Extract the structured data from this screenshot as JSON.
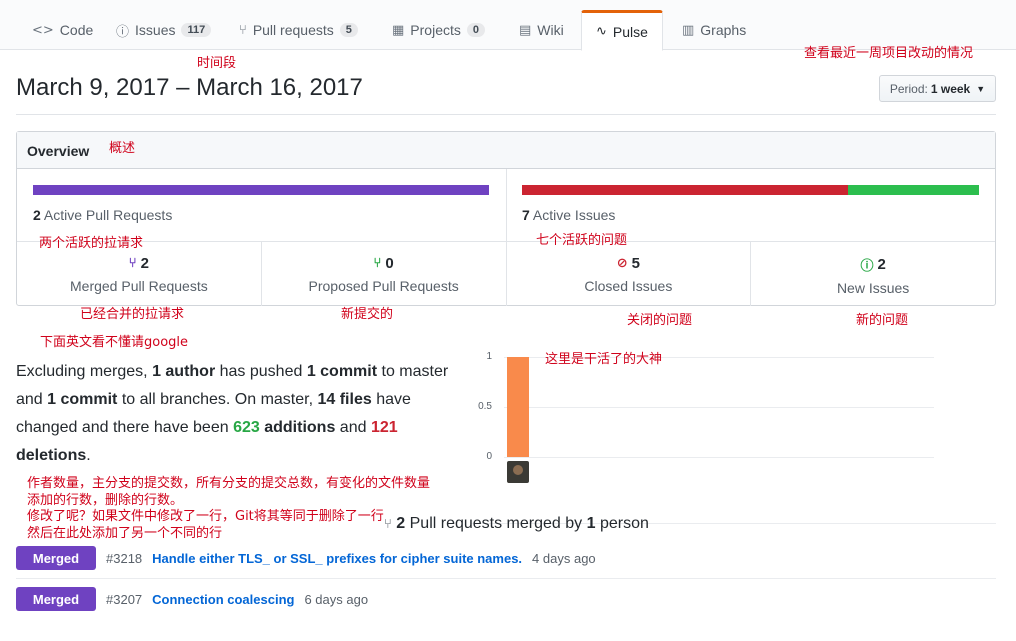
{
  "tabs": [
    {
      "icon": "code-icon",
      "glyph": "<>",
      "label": "Code",
      "count": ""
    },
    {
      "icon": "issue-icon",
      "glyph": "ⓘ",
      "label": "Issues",
      "count": "117"
    },
    {
      "icon": "pull-request-icon",
      "glyph": "⑂",
      "label": "Pull requests",
      "count": "5"
    },
    {
      "icon": "project-icon",
      "glyph": "▦",
      "label": "Projects",
      "count": "0"
    },
    {
      "icon": "wiki-icon",
      "glyph": "▤",
      "label": "Wiki",
      "count": ""
    },
    {
      "icon": "pulse-icon",
      "glyph": "∿",
      "label": "Pulse",
      "count": ""
    },
    {
      "icon": "graph-icon",
      "glyph": "▥",
      "label": "Graphs",
      "count": ""
    }
  ],
  "header": {
    "date_range": "March 9, 2017 – March 16, 2017",
    "period_label": "Period:",
    "period_value": "1 week"
  },
  "overview": {
    "title": "Overview",
    "active_prs_count": "2",
    "active_prs_label": "Active Pull Requests",
    "active_issues_count": "7",
    "active_issues_label": "Active Issues",
    "merged_prs_count": "2",
    "merged_prs_label": "Merged Pull Requests",
    "proposed_prs_count": "0",
    "proposed_prs_label": "Proposed Pull Requests",
    "closed_issues_count": "5",
    "closed_issues_label": "Closed Issues",
    "new_issues_count": "2",
    "new_issues_label": "New Issues",
    "issue_split": {
      "closed": 5,
      "open": 2
    }
  },
  "summary": {
    "t1": "Excluding merges, ",
    "authors": "1 author",
    "t2": " has pushed ",
    "commits_master": "1 commit",
    "t3": " to master and ",
    "commits_all": "1 commit",
    "t4": " to all branches. On master, ",
    "files": "14 files",
    "t5": " have changed and there have been ",
    "additions_num": "623",
    "additions_word": " additions",
    "t6": " and ",
    "deletions_num": "121",
    "deletions_word": "deletions",
    "t7": "."
  },
  "chart_data": {
    "type": "bar",
    "categories": [
      "contributor"
    ],
    "values": [
      1
    ],
    "ylim": [
      0,
      1
    ],
    "yticks": [
      "1",
      "0.5",
      "0"
    ],
    "color": "#f98a4b"
  },
  "prs_merged": {
    "count": "2",
    "t1": " Pull requests merged by ",
    "people": "1",
    "t2": " person",
    "items": [
      {
        "badge": "Merged",
        "number": "#3218",
        "title": "Handle either TLS_ or SSL_ prefixes for cipher suite names.",
        "time": "4 days ago"
      },
      {
        "badge": "Merged",
        "number": "#3207",
        "title": "Connection coalescing",
        "time": "6 days ago"
      }
    ]
  },
  "annotations": {
    "period": "时间段",
    "week": "查看最近一周项目改动的情况",
    "overview": "概述",
    "active_prs": "两个活跃的拉请求",
    "active_issues": "七个活跃的问题",
    "merged": "已经合并的拉请求",
    "proposed": "新提交的",
    "closed": "关闭的问题",
    "new": "新的问题",
    "google": "下面英文看不懂请google",
    "contributor": "这里是干活了的大神",
    "note1": "作者数量，主分支的提交数，所有分支的提交总数，有变化的文件数量",
    "note2": "添加的行数，删除的行数。",
    "note3": "修改了呢？如果文件中修改了一行，Git将其等同于删除了一行",
    "note4": "然后在此处添加了另一个不同的行"
  },
  "colors": {
    "accent": "#e36209",
    "purple": "#6f42c1",
    "red": "#cb2431",
    "green": "#2cbe4e",
    "link": "#0366d6"
  }
}
